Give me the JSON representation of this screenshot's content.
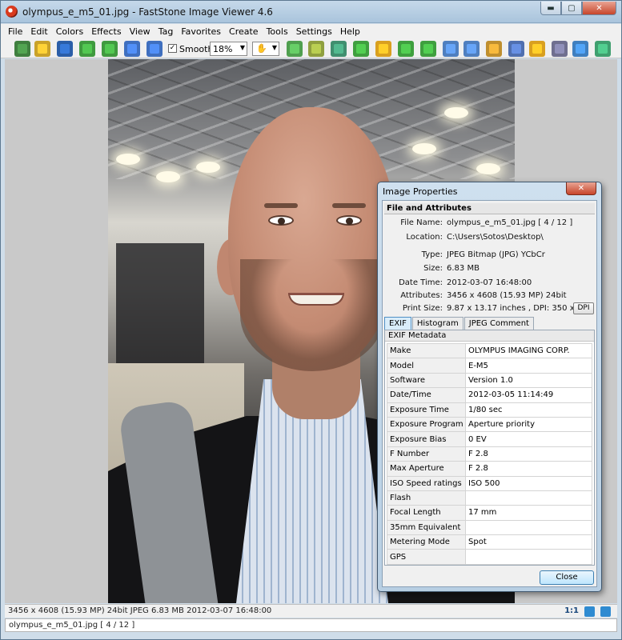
{
  "window": {
    "title": "olympus_e_m5_01.jpg  -  FastStone Image Viewer 4.6",
    "min_glyph": "▬",
    "max_glyph": "▢",
    "close_glyph": "✕"
  },
  "menu": [
    "File",
    "Edit",
    "Colors",
    "Effects",
    "View",
    "Tag",
    "Favorites",
    "Create",
    "Tools",
    "Settings",
    "Help"
  ],
  "toolbar": {
    "smooth_label": "Smooth",
    "smooth_checked_glyph": "✓",
    "zoom_value": "18%",
    "hand_glyph": "✋",
    "dropdown_glyph": "▼",
    "icons": [
      {
        "name": "acquire-camera-icon",
        "color": "#3f7f3f"
      },
      {
        "name": "open-folder-icon",
        "color": "#c9a22a"
      },
      {
        "name": "save-icon",
        "color": "#2a5ea8"
      },
      {
        "name": "previous-icon",
        "color": "#3f9a3f"
      },
      {
        "name": "next-icon",
        "color": "#3f9a3f"
      },
      {
        "name": "zoom-in-icon",
        "color": "#3f6fbf"
      },
      {
        "name": "zoom-out-icon",
        "color": "#3f6fbf"
      },
      {
        "name": "fit-icon",
        "color": "#4f9f4f"
      },
      {
        "name": "actual-size-icon",
        "color": "#8f9f3f"
      },
      {
        "name": "slideshow-icon",
        "color": "#3f8f6f"
      },
      {
        "name": "tag-icon",
        "color": "#3f9f3f"
      },
      {
        "name": "adjust-colors-icon",
        "color": "#d9a020"
      },
      {
        "name": "rotate-left-icon",
        "color": "#3f9f3f"
      },
      {
        "name": "rotate-right-icon",
        "color": "#3f9f3f"
      },
      {
        "name": "flip-icon",
        "color": "#4f7fbf"
      },
      {
        "name": "resize-icon",
        "color": "#4f7fbf"
      },
      {
        "name": "crop-icon",
        "color": "#bf8f2f"
      },
      {
        "name": "draw-icon",
        "color": "#4f6faf"
      },
      {
        "name": "email-icon",
        "color": "#d9a020"
      },
      {
        "name": "print-icon",
        "color": "#6f6f8f"
      },
      {
        "name": "properties-icon",
        "color": "#3f7fbf"
      },
      {
        "name": "fullscreen-icon",
        "color": "#3f9f6f"
      }
    ]
  },
  "status": {
    "info": "3456 x 4608 (15.93 MP)  24bit  JPEG   6.83 MB   2012-03-07 16:48:00",
    "ratio": "1:1",
    "file": "olympus_e_m5_01.jpg [ 4 / 12 ]"
  },
  "dialog": {
    "title": "Image Properties",
    "close_glyph": "✕",
    "section": "File and Attributes",
    "fields": [
      {
        "label": "File Name:",
        "value": "olympus_e_m5_01.jpg   [ 4 / 12 ]"
      },
      {
        "label": "Location:",
        "value": "C:\\Users\\Sotos\\Desktop\\"
      },
      {
        "label": "Type:",
        "value": "JPEG Bitmap (JPG) YCbCr"
      },
      {
        "label": "Size:",
        "value": "6.83 MB"
      },
      {
        "label": "Date Time:",
        "value": "2012-03-07 16:48:00"
      },
      {
        "label": "Attributes:",
        "value": "3456 x 4608 (15.93 MP)  24bit"
      },
      {
        "label": "Print Size:",
        "value": "9.87 x 13.17 inches ,  DPI: 350 x 350"
      }
    ],
    "dpi_button": "DPI",
    "tabs": [
      "EXIF",
      "Histogram",
      "JPEG Comment"
    ],
    "exif_header": "EXIF Metadata",
    "exif": [
      {
        "key": "Make",
        "value": "OLYMPUS IMAGING CORP."
      },
      {
        "key": "Model",
        "value": "E-M5"
      },
      {
        "key": "Software",
        "value": "Version 1.0"
      },
      {
        "key": "Date/Time",
        "value": "2012-03-05 11:14:49"
      },
      {
        "key": "Exposure Time",
        "value": "1/80 sec"
      },
      {
        "key": "Exposure Program",
        "value": "Aperture priority"
      },
      {
        "key": "Exposure Bias",
        "value": "0 EV"
      },
      {
        "key": "F Number",
        "value": "F 2.8"
      },
      {
        "key": "Max Aperture",
        "value": "F 2.8"
      },
      {
        "key": "ISO Speed ratings",
        "value": "ISO 500"
      },
      {
        "key": "Flash",
        "value": ""
      },
      {
        "key": "Focal Length",
        "value": "17 mm"
      },
      {
        "key": "35mm Equivalent",
        "value": ""
      },
      {
        "key": "Metering Mode",
        "value": "Spot"
      },
      {
        "key": "GPS",
        "value": ""
      }
    ],
    "close_button": "Close"
  }
}
